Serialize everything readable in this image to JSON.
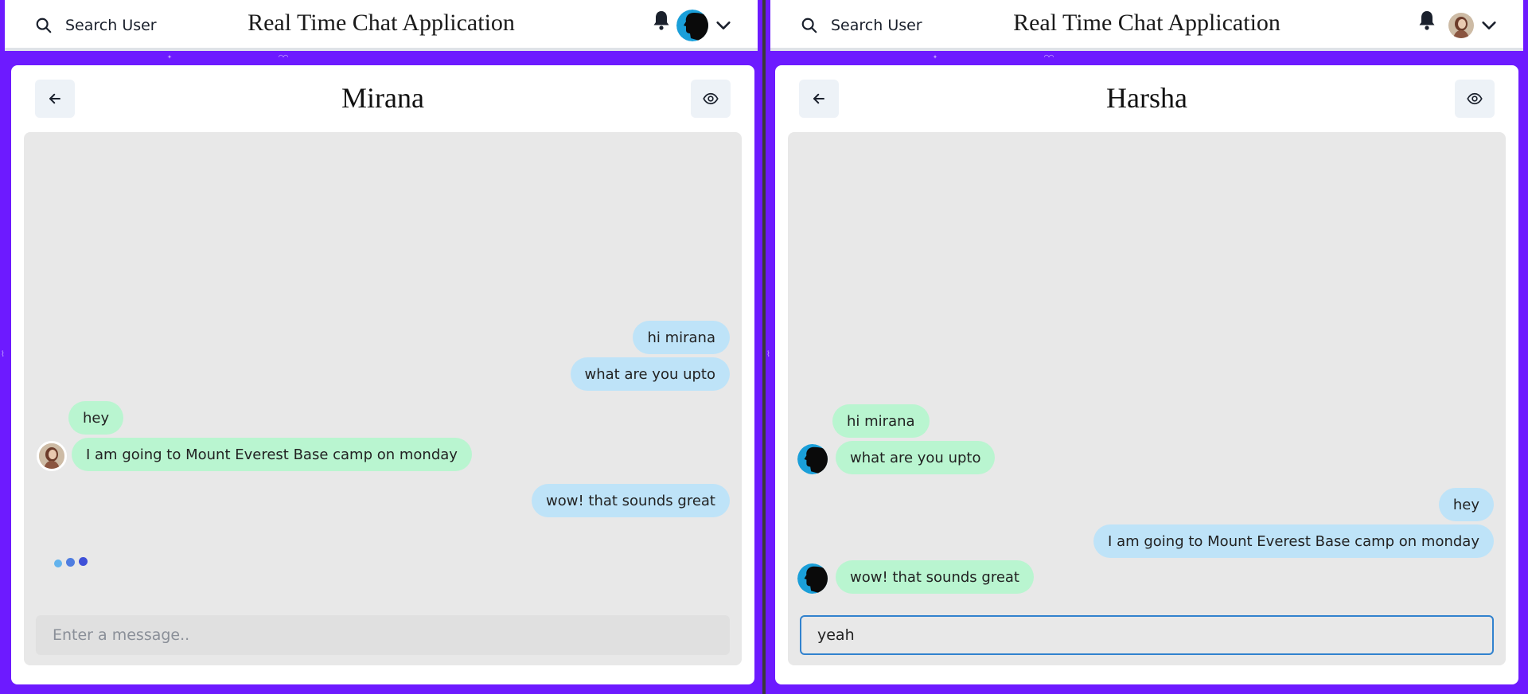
{
  "colors": {
    "page_background": "#6d1aff",
    "sent_bubble": "#bee3f8",
    "received_bubble": "#b9f5d0",
    "chat_area": "#e8e8e8",
    "input_focus_border": "#3182ce",
    "avatar_blue": "#1a9fd9"
  },
  "left_window": {
    "header": {
      "search_icon": "search-icon",
      "search_label": "Search User",
      "app_title": "Real Time Chat Application",
      "bell_icon": "bell-icon",
      "avatar_icon": "silhouette-avatar",
      "menu_icon": "chevron-down-icon"
    },
    "chat": {
      "back_icon": "arrow-left-icon",
      "name": "Mirana",
      "view_icon": "eye-icon",
      "messages": [
        {
          "text": "hi mirana",
          "from": "me"
        },
        {
          "text": "what are you upto",
          "from": "me"
        },
        {
          "text": "hey",
          "from": "other"
        },
        {
          "text": "I am going to Mount Everest Base camp on monday",
          "from": "other"
        },
        {
          "text": "wow! that sounds great",
          "from": "me"
        }
      ],
      "typing_indicator": "typing-dots-icon",
      "input_value": "",
      "input_placeholder": "Enter a message.."
    }
  },
  "right_window": {
    "header": {
      "search_icon": "search-icon",
      "search_label": "Search User",
      "app_title": "Real Time Chat Application",
      "bell_icon": "bell-icon",
      "avatar_icon": "photo-avatar",
      "menu_icon": "chevron-down-icon"
    },
    "chat": {
      "back_icon": "arrow-left-icon",
      "name": "Harsha",
      "view_icon": "eye-icon",
      "messages": [
        {
          "text": "hi mirana",
          "from": "other"
        },
        {
          "text": "what are you upto",
          "from": "other"
        },
        {
          "text": "hey",
          "from": "me"
        },
        {
          "text": "I am going to Mount Everest Base camp on monday",
          "from": "me"
        },
        {
          "text": "wow! that sounds great",
          "from": "other"
        }
      ],
      "input_value": "yeah",
      "input_placeholder": "Enter a message.."
    }
  }
}
